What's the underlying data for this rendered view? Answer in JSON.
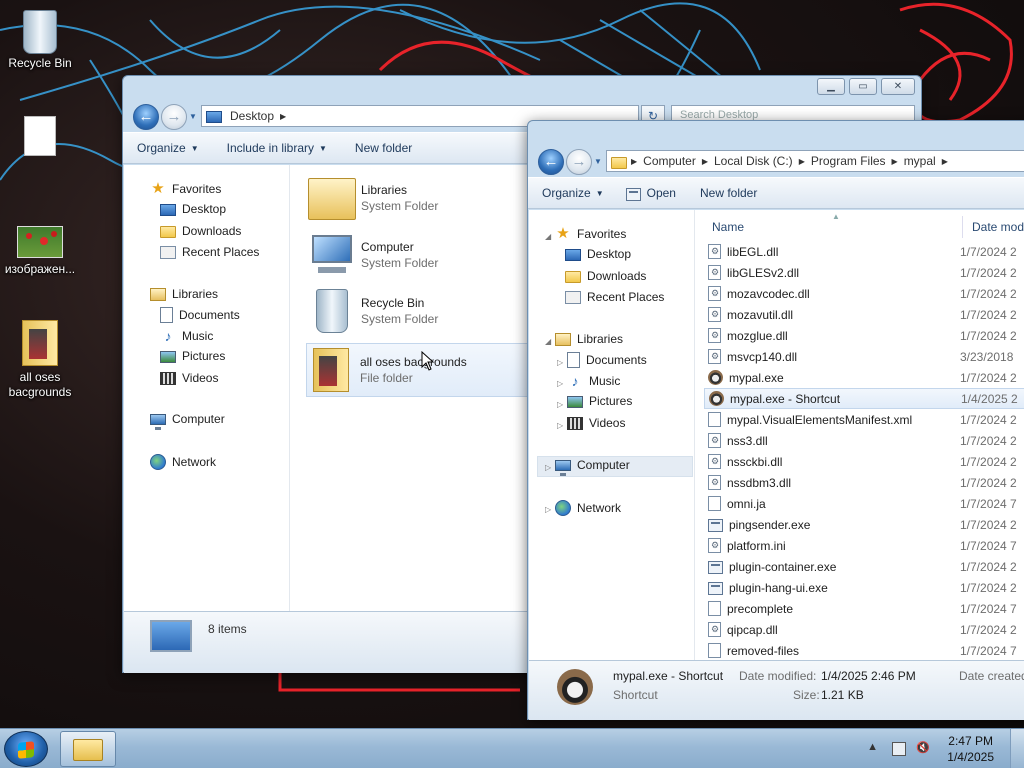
{
  "desktop": {
    "icons": [
      {
        "label": "Recycle Bin",
        "icon": "recycle-bin-icon"
      },
      {
        "label": "",
        "icon": "blank-file-icon"
      },
      {
        "label": "изображен...",
        "icon": "image-file-icon"
      },
      {
        "label": "all oses bacgrounds",
        "icon": "folder-icon"
      }
    ]
  },
  "explorer1": {
    "address": {
      "segments": [
        "Desktop"
      ]
    },
    "search_placeholder": "Search Desktop",
    "toolbar": {
      "organize": "Organize",
      "include": "Include in library",
      "new_folder": "New folder"
    },
    "nav": {
      "favorites": "Favorites",
      "desktop": "Desktop",
      "downloads": "Downloads",
      "recent": "Recent Places",
      "libraries": "Libraries",
      "documents": "Documents",
      "music": "Music",
      "pictures": "Pictures",
      "videos": "Videos",
      "computer": "Computer",
      "network": "Network"
    },
    "items": [
      {
        "name": "Libraries",
        "type": "System Folder"
      },
      {
        "name": "Computer",
        "type": "System Folder"
      },
      {
        "name": "Recycle Bin",
        "type": "System Folder"
      },
      {
        "name": "all oses bacgrounds",
        "type": "File folder"
      }
    ],
    "status_count": "8 items"
  },
  "explorer2": {
    "address": {
      "segments": [
        "Computer",
        "Local Disk (C:)",
        "Program Files",
        "mypal"
      ]
    },
    "toolbar": {
      "organize": "Organize",
      "open": "Open",
      "new_folder": "New folder"
    },
    "nav": {
      "favorites": "Favorites",
      "desktop": "Desktop",
      "downloads": "Downloads",
      "recent": "Recent Places",
      "libraries": "Libraries",
      "documents": "Documents",
      "music": "Music",
      "pictures": "Pictures",
      "videos": "Videos",
      "computer": "Computer",
      "network": "Network"
    },
    "columns": {
      "name": "Name",
      "date": "Date mod"
    },
    "files": [
      {
        "name": "libEGL.dll",
        "date": "1/7/2024 2",
        "icon": "dll-icon"
      },
      {
        "name": "libGLESv2.dll",
        "date": "1/7/2024 2",
        "icon": "dll-icon"
      },
      {
        "name": "mozavcodec.dll",
        "date": "1/7/2024 2",
        "icon": "dll-icon"
      },
      {
        "name": "mozavutil.dll",
        "date": "1/7/2024 2",
        "icon": "dll-icon"
      },
      {
        "name": "mozglue.dll",
        "date": "1/7/2024 2",
        "icon": "dll-icon"
      },
      {
        "name": "msvcp140.dll",
        "date": "3/23/2018",
        "icon": "dll-icon"
      },
      {
        "name": "mypal.exe",
        "date": "1/7/2024 2",
        "icon": "mypal-app-icon"
      },
      {
        "name": "mypal.exe - Shortcut",
        "date": "1/4/2025 2",
        "icon": "mypal-shortcut-icon"
      },
      {
        "name": "mypal.VisualElementsManifest.xml",
        "date": "1/7/2024 2",
        "icon": "xml-file-icon"
      },
      {
        "name": "nss3.dll",
        "date": "1/7/2024 2",
        "icon": "dll-icon"
      },
      {
        "name": "nssckbi.dll",
        "date": "1/7/2024 2",
        "icon": "dll-icon"
      },
      {
        "name": "nssdbm3.dll",
        "date": "1/7/2024 2",
        "icon": "dll-icon"
      },
      {
        "name": "omni.ja",
        "date": "1/7/2024 7",
        "icon": "file-icon"
      },
      {
        "name": "pingsender.exe",
        "date": "1/7/2024 2",
        "icon": "exe-icon"
      },
      {
        "name": "platform.ini",
        "date": "1/7/2024 7",
        "icon": "ini-file-icon"
      },
      {
        "name": "plugin-container.exe",
        "date": "1/7/2024 2",
        "icon": "exe-icon"
      },
      {
        "name": "plugin-hang-ui.exe",
        "date": "1/7/2024 2",
        "icon": "exe-icon"
      },
      {
        "name": "precomplete",
        "date": "1/7/2024 7",
        "icon": "file-icon"
      },
      {
        "name": "qipcap.dll",
        "date": "1/7/2024 2",
        "icon": "dll-icon"
      },
      {
        "name": "removed-files",
        "date": "1/7/2024 7",
        "icon": "file-icon"
      }
    ],
    "selected_index": 7,
    "details": {
      "name": "mypal.exe - Shortcut",
      "type": "Shortcut",
      "modified_label": "Date modified:",
      "modified_value": "1/4/2025 2:46 PM",
      "size_label": "Size:",
      "size_value": "1.21 KB",
      "created_label": "Date created"
    }
  },
  "taskbar": {
    "time": "2:47 PM",
    "date": "1/4/2025"
  }
}
